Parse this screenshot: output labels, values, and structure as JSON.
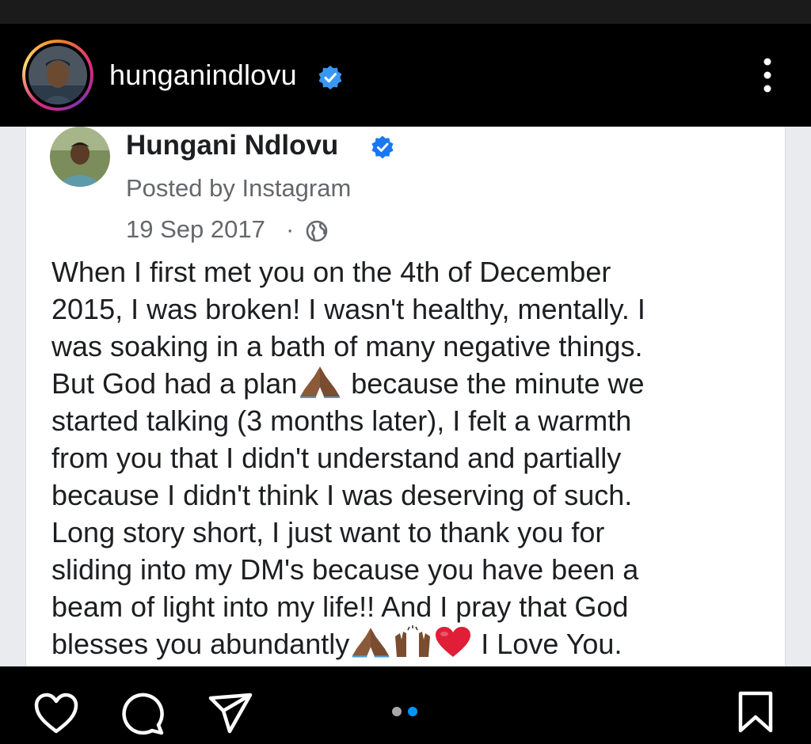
{
  "header": {
    "username": "hunganindlovu",
    "verified_icon": "verified-badge-icon",
    "menu_icon": "more-vertical-icon"
  },
  "post": {
    "author": "Hungani Ndlovu",
    "posted_by": "Posted by Instagram",
    "date": "19 Sep 2017",
    "separator": "·",
    "privacy_icon": "globe-icon",
    "body_lines": [
      "When I first met you on the 4th of December",
      "2015, I was broken! I wasn't healthy, mentally. I",
      "was soaking in a bath of many negative things.",
      "But God had a plan",
      " because the minute we",
      "started talking (3 months later), I felt a warmth",
      "from you that I didn't understand and partially",
      "because I didn't think I was deserving of such.",
      "Long story short, I just want to thank you for",
      "sliding into my DM's because you have been a",
      "beam of light into my life!! And I pray that God",
      "blesses you abundantly",
      " I Love You."
    ],
    "emojis": [
      "praying-hands-icon",
      "praying-hands-icon",
      "raised-hands-icon",
      "red-heart-icon"
    ]
  },
  "actions": {
    "like_icon": "heart-icon",
    "comment_icon": "comment-icon",
    "share_icon": "send-icon",
    "save_icon": "bookmark-icon",
    "carousel_pages": 2,
    "carousel_active": 2
  },
  "colors": {
    "verified_blue": "#3897f0",
    "fb_verified_blue": "#1877f2",
    "carousel_active": "#0095f6",
    "carousel_inactive": "#a8a8a8"
  }
}
